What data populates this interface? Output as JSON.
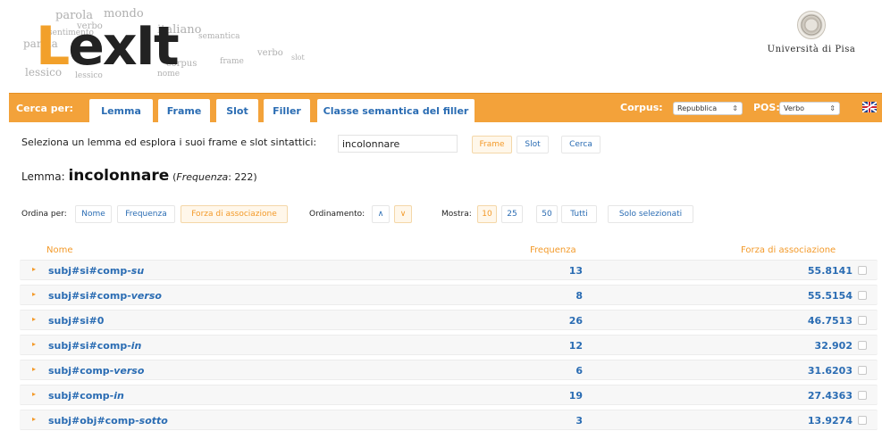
{
  "header": {
    "logo_parts": [
      "L",
      "ex",
      "It"
    ],
    "cloud_words": [
      "parola",
      "mondo",
      "parola",
      "verbo",
      "sentimento",
      "italiano",
      "semantica",
      "lessico",
      "lessico",
      "corpus",
      "verbo",
      "frame",
      "slot",
      "nome"
    ],
    "university": "Università di Pisa"
  },
  "navbar": {
    "search_label": "Cerca per:",
    "tabs": [
      "Lemma",
      "Frame",
      "Slot",
      "Filler",
      "Classe semantica del filler"
    ],
    "corpus_label": "Corpus:",
    "corpus_value": "Repubblica",
    "pos_label": "POS:",
    "pos_value": "Verbo",
    "flag_icon": "uk-flag-icon",
    "accent_color": "#f3a23a"
  },
  "search": {
    "prompt": "Seleziona un lemma ed esplora i suoi frame e slot sintattici:",
    "value": "incolonnare",
    "buttons": [
      "Frame",
      "Slot",
      "Cerca"
    ]
  },
  "lemma": {
    "label": "Lemma:",
    "word": "incolonnare",
    "freq_label": "Frequenza",
    "freq_value": "222"
  },
  "controls": {
    "sort_label": "Ordina per:",
    "sort_options": [
      "Nome",
      "Frequenza",
      "Forza di associazione"
    ],
    "order_label": "Ordinamento:",
    "order_options": [
      "∧",
      "∨"
    ],
    "show_label": "Mostra:",
    "show_options": [
      "10",
      "25",
      "50",
      "Tutti"
    ],
    "selected_label": "Solo selezionati"
  },
  "table": {
    "headers": [
      "Nome",
      "Frequenza",
      "Forza di associazione"
    ],
    "rows": [
      {
        "prefix": "subj#si#comp-",
        "suffix": "su",
        "freq": "13",
        "assoc": "55.8141"
      },
      {
        "prefix": "subj#si#comp-",
        "suffix": "verso",
        "freq": "8",
        "assoc": "55.5154"
      },
      {
        "prefix": "subj#si#0",
        "suffix": "",
        "freq": "26",
        "assoc": "46.7513"
      },
      {
        "prefix": "subj#si#comp-",
        "suffix": "in",
        "freq": "12",
        "assoc": "32.902"
      },
      {
        "prefix": "subj#comp-",
        "suffix": "verso",
        "freq": "6",
        "assoc": "31.6203"
      },
      {
        "prefix": "subj#comp-",
        "suffix": "in",
        "freq": "19",
        "assoc": "27.4363"
      },
      {
        "prefix": "subj#obj#comp-",
        "suffix": "sotto",
        "freq": "3",
        "assoc": "13.9274"
      }
    ]
  }
}
